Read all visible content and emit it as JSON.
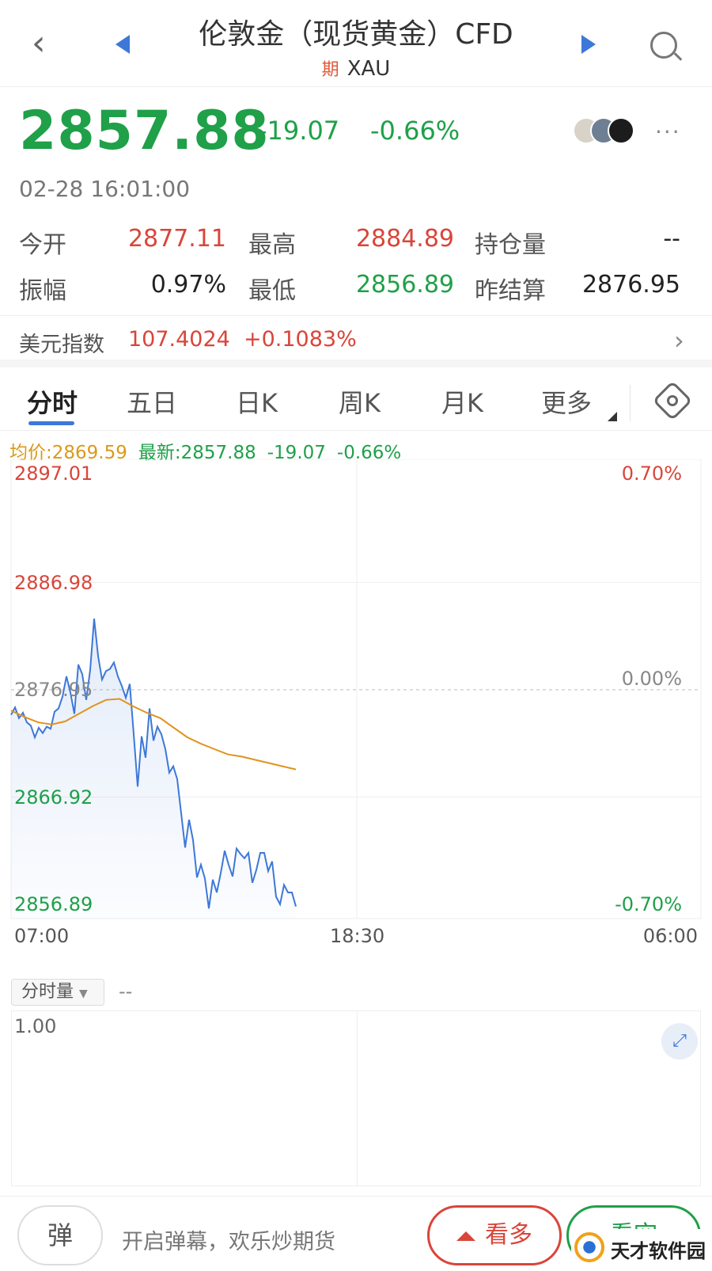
{
  "header": {
    "title": "伦敦金（现货黄金）CFD",
    "futures_icon": "期",
    "symbol": "XAU",
    "back_icon": "chevron-left-icon",
    "prev_icon": "triangle-left-icon",
    "next_icon": "triangle-right-icon",
    "search_icon": "search-icon"
  },
  "quote": {
    "price": "2857.88",
    "change": "-19.07",
    "change_pct": "-0.66%",
    "timestamp": "02-28 16:01:00",
    "more": "···"
  },
  "stats": [
    {
      "label": "今开",
      "value": "2877.11",
      "color": "red"
    },
    {
      "label": "最高",
      "value": "2884.89",
      "color": "red"
    },
    {
      "label": "持仓量",
      "value": "--",
      "color": "dark"
    },
    {
      "label": "振幅",
      "value": "0.97%",
      "color": "dark"
    },
    {
      "label": "最低",
      "value": "2856.89",
      "color": "green"
    },
    {
      "label": "昨结算",
      "value": "2876.95",
      "color": "dark"
    }
  ],
  "dxy": {
    "label": "美元指数",
    "value": "107.4024",
    "change_pct": "+0.1083%"
  },
  "tabs": [
    "分时",
    "五日",
    "日K",
    "周K",
    "月K",
    "更多"
  ],
  "legend": {
    "avg": "均价:2869.59",
    "latest": "最新:2857.88",
    "change": "-19.07",
    "change_pct": "-0.66%"
  },
  "chart_data": {
    "type": "line",
    "y_labels": [
      "2897.01",
      "2886.98",
      "2876.95",
      "2866.92",
      "2856.89"
    ],
    "pct_labels": [
      "0.70%",
      "0.00%",
      "-0.70%"
    ],
    "x_labels": [
      "07:00",
      "18:30",
      "06:00"
    ],
    "ylim": [
      2856.89,
      2897.01
    ],
    "baseline": 2876.95,
    "series": [
      {
        "values": [
          2874.6,
          2875.3,
          2874.3,
          2874.8,
          2873.9,
          2873.6,
          2872.5,
          2873.4,
          2872.9,
          2873.5,
          2873.3,
          2874.9,
          2875.2,
          2876.3,
          2878.2,
          2876.7,
          2874.7,
          2879.3,
          2878.4,
          2876.0,
          2878.8,
          2883.6,
          2880.1,
          2877.9,
          2878.7,
          2878.9,
          2879.5,
          2878.2,
          2877.3,
          2876.2,
          2877.5,
          2872.8,
          2867.9,
          2872.6,
          2870.6,
          2875.2,
          2872.2,
          2873.5,
          2872.8,
          2871.4,
          2869.2,
          2869.8,
          2868.6,
          2865.4,
          2862.2,
          2864.8,
          2862.9,
          2859.4,
          2860.6,
          2859.3,
          2856.5,
          2859.2,
          2858.0,
          2859.8,
          2861.9,
          2860.6,
          2859.5,
          2862.1,
          2861.6,
          2861.2,
          2861.7,
          2858.9,
          2860.1,
          2861.7,
          2861.7,
          2860.0,
          2860.9,
          2857.6,
          2856.9,
          2858.7,
          2858.0,
          2858.0,
          2856.7
        ],
        "color": "#3d78d8"
      },
      {
        "values": [
          2875.0,
          2874.4,
          2873.9,
          2873.7,
          2874.0,
          2874.7,
          2875.4,
          2876.0,
          2876.1,
          2875.4,
          2874.8,
          2874.3,
          2873.4,
          2872.5,
          2871.9,
          2871.4,
          2870.9,
          2870.7,
          2870.4,
          2870.1,
          2869.8,
          2869.5
        ],
        "color": "#e0931f"
      }
    ]
  },
  "volume": {
    "selector": "分时量",
    "selector_icon": "caret-down-icon",
    "value": "--",
    "max_label": "1.00",
    "expand_icon": "expand-icon"
  },
  "bottom": {
    "danmu_label": "弹",
    "danmu_text": "开启弹幕，欢乐炒期货",
    "bull_label": "看多",
    "bear_label": "看空",
    "watermark_text": "天才软件园"
  },
  "colors": {
    "up": "#d9453a",
    "down": "#1fa049",
    "accent": "#3d78d8",
    "avg": "#e0931f"
  }
}
